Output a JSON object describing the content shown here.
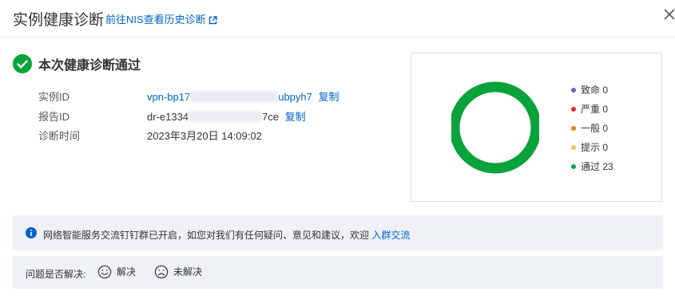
{
  "header": {
    "title": "实例健康诊断",
    "history_link": "前往NIS查看历史诊断"
  },
  "result": {
    "title": "本次健康诊断通过",
    "rows": [
      {
        "label": "实例ID",
        "value_prefix": "vpn-bp17",
        "value_suffix": "ubpyh7",
        "copy": "复制"
      },
      {
        "label": "报告ID",
        "value_prefix": "dr-e1334",
        "value_suffix": "7ce",
        "copy": "复制"
      },
      {
        "label": "诊断时间",
        "value": "2023年3月20日 14:09:02"
      }
    ]
  },
  "chart_data": {
    "type": "pie",
    "categories": [
      "致命",
      "严重",
      "一般",
      "提示",
      "通过"
    ],
    "values": [
      0,
      0,
      0,
      0,
      23
    ],
    "colors": [
      "#6b5fc7",
      "#d93026",
      "#f27d13",
      "#f5c242",
      "#0aa23a"
    ],
    "legend_placement": "right"
  },
  "legend": [
    {
      "label": "致命",
      "count": "0",
      "color": "#6b5fc7"
    },
    {
      "label": "严重",
      "count": "0",
      "color": "#d93026"
    },
    {
      "label": "一般",
      "count": "0",
      "color": "#f27d13"
    },
    {
      "label": "提示",
      "count": "0",
      "color": "#f5c242"
    },
    {
      "label": "通过",
      "count": "23",
      "color": "#0aa23a"
    }
  ],
  "notice": {
    "text": "网络智能服务交流钉钉群已开启，如您对我们有任何疑问、意见和建议，欢迎",
    "link": "入群交流"
  },
  "feedback": {
    "question": "问题是否解决:",
    "solved": "解决",
    "unsolved": "未解决"
  },
  "colors": {
    "accent": "#0064c8",
    "success": "#0aa23a"
  }
}
